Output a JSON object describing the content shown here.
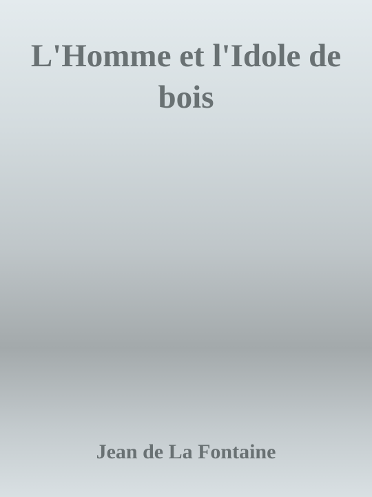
{
  "cover": {
    "title": "L'Homme et l'Idole de bois",
    "author": "Jean de La Fontaine",
    "colors": {
      "text": "#697173",
      "background_top": "#e4ebee",
      "background_mid": "#a3a9ab",
      "background_bottom": "#d9e0e3"
    }
  }
}
